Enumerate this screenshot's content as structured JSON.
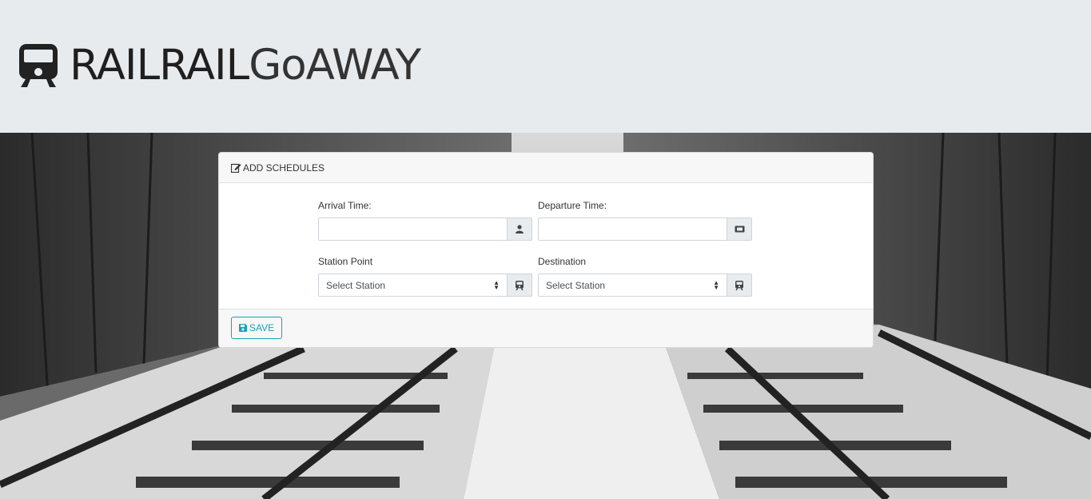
{
  "brand": {
    "bold": "RAILRAIL",
    "light": "GoAWAY",
    "logo_icon": "train-icon"
  },
  "card": {
    "header_icon": "edit-icon",
    "title": "ADD SCHEDULES",
    "fields": {
      "arrival": {
        "label": "Arrival Time:",
        "value": "",
        "addon_icon": "user-icon"
      },
      "departure": {
        "label": "Departure Time:",
        "value": "",
        "addon_icon": "ticket-icon"
      },
      "station_point": {
        "label": "Station Point",
        "selected": "Select Station",
        "addon_icon": "train-icon"
      },
      "destination": {
        "label": "Destination",
        "selected": "Select Station",
        "addon_icon": "train-icon"
      }
    },
    "save_label": "SAVE",
    "save_icon": "save-icon"
  },
  "colors": {
    "accent": "#17a2b8",
    "jumbotron_bg": "#e8ebee"
  }
}
